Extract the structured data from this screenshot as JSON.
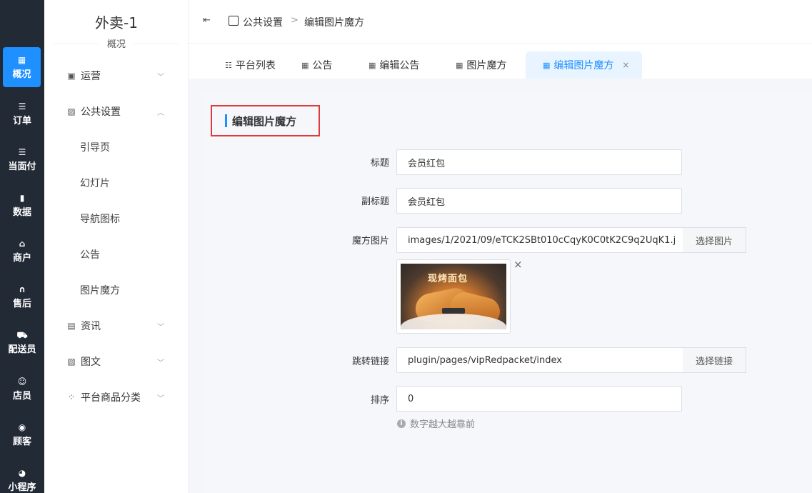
{
  "rail": [
    {
      "label": "概况",
      "icon": "grid-icon",
      "glyph": "▦",
      "active": true
    },
    {
      "label": "订单",
      "icon": "list-icon",
      "glyph": "☰"
    },
    {
      "label": "当面付",
      "icon": "list-icon",
      "glyph": "☰"
    },
    {
      "label": "数据",
      "icon": "bar-chart-icon",
      "glyph": "▮"
    },
    {
      "label": "商户",
      "icon": "store-icon",
      "glyph": "⌂"
    },
    {
      "label": "售后",
      "icon": "headset-icon",
      "glyph": "∩"
    },
    {
      "label": "配送员",
      "icon": "delivery-icon",
      "glyph": "⛟"
    },
    {
      "label": "店员",
      "icon": "users-icon",
      "glyph": "☺"
    },
    {
      "label": "顾客",
      "icon": "user-circle-icon",
      "glyph": "◉"
    },
    {
      "label": "小程序",
      "icon": "wechat-icon",
      "glyph": "◕"
    }
  ],
  "sidebar": {
    "title": "外卖-1",
    "subtitle": "概况",
    "items": [
      {
        "label": "运营",
        "icon": "operations-icon",
        "glyph": "▣",
        "chevron": "﹀"
      },
      {
        "label": "公共设置",
        "icon": "image-icon",
        "glyph": "▨",
        "chevron": "︿"
      },
      {
        "label": "引导页",
        "sub": true
      },
      {
        "label": "幻灯片",
        "sub": true
      },
      {
        "label": "导航图标",
        "sub": true
      },
      {
        "label": "公告",
        "sub": true
      },
      {
        "label": "图片魔方",
        "sub": true
      },
      {
        "label": "资讯",
        "icon": "news-icon",
        "glyph": "▤",
        "chevron": "﹀"
      },
      {
        "label": "图文",
        "icon": "picture-text-icon",
        "glyph": "▧",
        "chevron": "﹀"
      },
      {
        "label": "平台商品分类",
        "icon": "category-icon",
        "glyph": "⁘",
        "chevron": "﹀"
      }
    ]
  },
  "breadcrumb": {
    "fold_glyph": "⇤",
    "parent": "公共设置",
    "separator": ">",
    "current": "编辑图片魔方"
  },
  "tabs": [
    {
      "label": "平台列表",
      "icon": "list-icon",
      "glyph": "☷"
    },
    {
      "label": "公告",
      "icon": "grid-icon",
      "glyph": "▦"
    },
    {
      "label": "编辑公告",
      "icon": "grid-icon",
      "glyph": "▦"
    },
    {
      "label": "图片魔方",
      "icon": "grid-icon",
      "glyph": "▦"
    },
    {
      "label": "编辑图片魔方",
      "icon": "grid-icon",
      "glyph": "▦",
      "active": true,
      "close": "×"
    }
  ],
  "form": {
    "heading": "编辑图片魔方",
    "title_label": "标题",
    "title_value": "会员红包",
    "subtitle_label": "副标题",
    "subtitle_value": "会员红包",
    "image_label": "魔方图片",
    "image_value": "images/1/2021/09/eTCK2SBt010cCqyK0C0tK2C9q2UqK1.j",
    "image_button": "选择图片",
    "image_caption": "现烤面包",
    "image_remove": "×",
    "link_label": "跳转链接",
    "link_value": "plugin/pages/vipRedpacket/index",
    "link_button": "选择链接",
    "sort_label": "排序",
    "sort_value": "0",
    "sort_hint": "数字越大越靠前"
  },
  "colors": {
    "accent": "#1e90ff",
    "rail_bg": "#222a36",
    "highlight_border": "#e03a3a"
  }
}
